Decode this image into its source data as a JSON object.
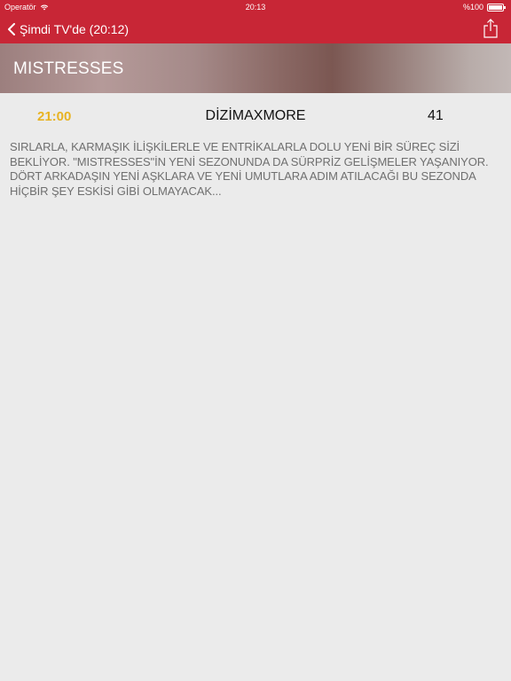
{
  "status_bar": {
    "carrier": "Operatör",
    "time": "20:13",
    "battery": "%100",
    "battery_level": 1.0
  },
  "nav": {
    "back_label": "Şimdi TV'de (20:12)",
    "back_icon": "chevron-left-icon",
    "share_icon": "share-icon"
  },
  "program": {
    "title": "MISTRESSES",
    "time": "21:00",
    "channel": "DİZİMAXMORE",
    "channel_number": "41",
    "description": "SIRLARLA, KARMAŞIK İLİŞKİLERLE VE ENTRİKALARLA DOLU YENİ BİR SÜREÇ SİZİ BEKLİYOR. \"MISTRESSES\"İN YENİ SEZONUNDA DA SÜRPRİZ GELİŞMELER YAŞANIYOR. DÖRT ARKADAŞIN YENİ AŞKLARA VE YENİ UMUTLARA ADIM ATILACAĞI BU SEZONDA HİÇBİR ŞEY ESKİSİ GİBİ OLMAYACAK..."
  },
  "colors": {
    "accent": "#c82636",
    "time_highlight": "#e8b323",
    "background": "#ebebeb",
    "description_text": "#6f6f6f"
  }
}
